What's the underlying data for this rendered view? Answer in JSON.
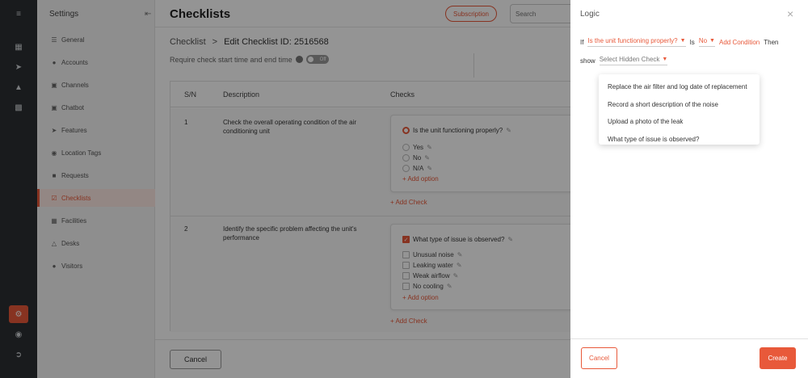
{
  "settings": {
    "title": "Settings",
    "items": [
      {
        "label": "General",
        "icon": "sliders-icon",
        "active": false
      },
      {
        "label": "Accounts",
        "icon": "users-icon",
        "active": false
      },
      {
        "label": "Channels",
        "icon": "channel-icon",
        "active": false
      },
      {
        "label": "Chatbot",
        "icon": "chatbot-icon",
        "active": false
      },
      {
        "label": "Features",
        "icon": "megaphone-icon",
        "active": false
      },
      {
        "label": "Location Tags",
        "icon": "location-pin-icon",
        "active": false
      },
      {
        "label": "Requests",
        "icon": "request-icon",
        "active": false
      },
      {
        "label": "Checklists",
        "icon": "clipboard-icon",
        "active": true
      },
      {
        "label": "Facilities",
        "icon": "facilities-icon",
        "active": false
      },
      {
        "label": "Desks",
        "icon": "desk-icon",
        "active": false
      },
      {
        "label": "Visitors",
        "icon": "visitors-icon",
        "active": false
      }
    ]
  },
  "header": {
    "title": "Checklists",
    "subscription_label": "Subscription",
    "search_placeholder": "Search"
  },
  "breadcrumb": {
    "root": "Checklist",
    "separator": ">",
    "current": "Edit Checklist ID: 2516568"
  },
  "toggle_row": {
    "label": "Require check start time and end time",
    "toggle_text": "Off"
  },
  "table": {
    "headers": {
      "sn": "S/N",
      "description": "Description",
      "checks": "Checks"
    },
    "rows": [
      {
        "sn": "1",
        "description": "Check the overall operating condition of the air conditioning unit",
        "question": "Is the unit functioning properly?",
        "question_type": "radio",
        "options": [
          "Yes",
          "No",
          "N/A"
        ],
        "add_option": "+ Add option",
        "add_check": "+ Add Check"
      },
      {
        "sn": "2",
        "description": "Identify the specific problem affecting the unit's performance",
        "question": "What type of issue is observed?",
        "question_type": "checkbox",
        "options": [
          "Unusual noise",
          "Leaking water",
          "Weak airflow",
          "No cooling"
        ],
        "add_option": "+ Add option",
        "add_check": "+ Add Check"
      }
    ]
  },
  "footer": {
    "cancel_label": "Cancel"
  },
  "logic": {
    "title": "Logic",
    "if_label": "If",
    "condition_question": "Is the unit functioning properly?",
    "is_label": "Is",
    "condition_value": "No",
    "add_condition": "Add Condition",
    "then_label": "Then",
    "show_label": "show",
    "hidden_check_placeholder": "Select Hidden Check",
    "dropdown_options": [
      "Replace the air filter and log date of replacement",
      "Record a short description of the noise",
      "Upload a photo of the leak",
      "What type of issue is observed?"
    ],
    "cancel_label": "Cancel",
    "create_label": "Create"
  },
  "colors": {
    "accent": "#e8593a",
    "rail": "#2b2f33"
  }
}
